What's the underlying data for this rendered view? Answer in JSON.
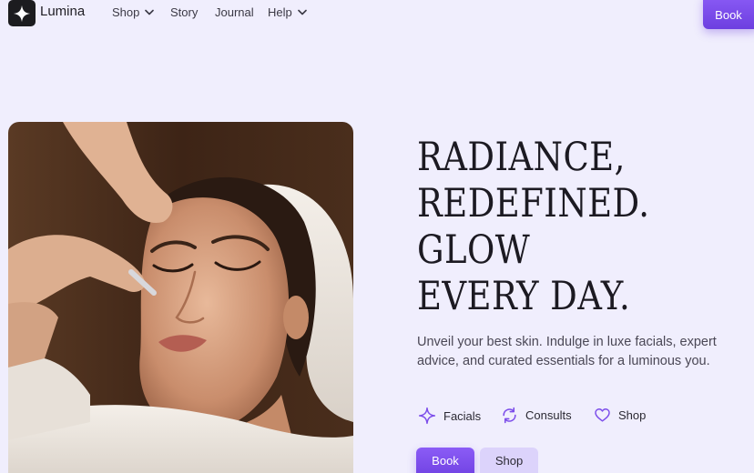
{
  "brand": {
    "name": "Lumina",
    "logo_icon": "sparkle-icon"
  },
  "nav": {
    "items": [
      {
        "label": "Shop",
        "has_dropdown": true
      },
      {
        "label": "Story",
        "has_dropdown": false
      },
      {
        "label": "Journal",
        "has_dropdown": false
      },
      {
        "label": "Help",
        "has_dropdown": true
      }
    ],
    "book_label": "Book"
  },
  "hero": {
    "headline": [
      "RADIANCE,",
      "REDEFINED.",
      "GLOW",
      "EVERY DAY."
    ],
    "subtext": "Unveil your best skin. Indulge in luxe facials, expert advice, and curated essentials for a luminous you.",
    "features": [
      {
        "label": "Facials",
        "icon": "sparkle-icon"
      },
      {
        "label": "Consults",
        "icon": "refresh-icon"
      },
      {
        "label": "Shop",
        "icon": "heart-icon"
      }
    ],
    "cta": {
      "primary": "Book",
      "secondary": "Shop"
    }
  },
  "colors": {
    "background": "#f0eefd",
    "accent": "#7c4dea",
    "accent_light": "#dcd3fb",
    "text_dark": "#1c1a22"
  }
}
